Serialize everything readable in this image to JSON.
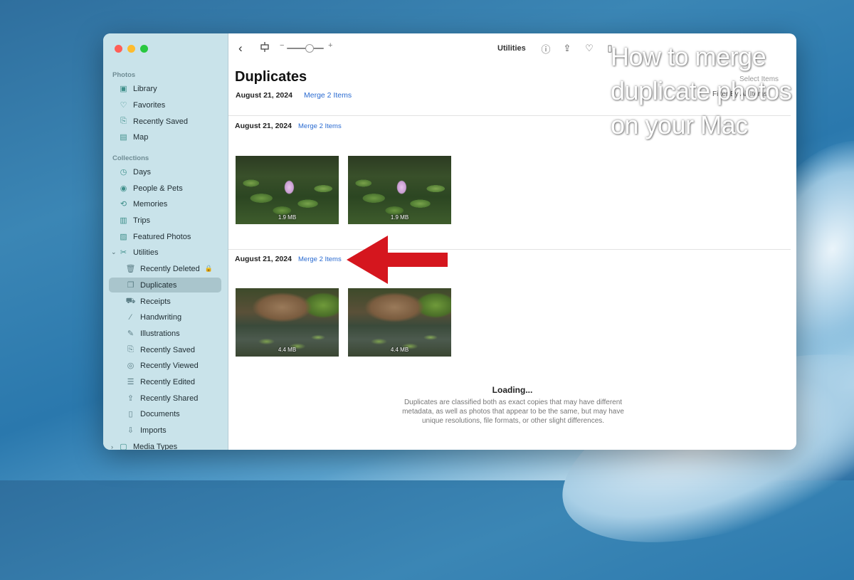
{
  "overlay": {
    "title_line1": "How to merge",
    "title_line2": "duplicate photos",
    "title_line3": "on your Mac"
  },
  "sidebar": {
    "section_photos": "Photos",
    "photos_items": [
      {
        "label": "Library",
        "icon": "library-icon"
      },
      {
        "label": "Favorites",
        "icon": "heart-icon"
      },
      {
        "label": "Recently Saved",
        "icon": "recently-saved-icon"
      },
      {
        "label": "Map",
        "icon": "map-icon"
      }
    ],
    "section_collections": "Collections",
    "collections_items": [
      {
        "label": "Days",
        "icon": "clock-icon"
      },
      {
        "label": "People & Pets",
        "icon": "person-icon"
      },
      {
        "label": "Memories",
        "icon": "memories-icon"
      },
      {
        "label": "Trips",
        "icon": "suitcase-icon"
      },
      {
        "label": "Featured Photos",
        "icon": "photo-icon"
      },
      {
        "label": "Utilities",
        "icon": "utilities-icon"
      }
    ],
    "utilities_items": [
      {
        "label": "Recently Deleted",
        "icon": "trash-icon"
      },
      {
        "label": "Duplicates",
        "icon": "duplicates-icon"
      },
      {
        "label": "Receipts",
        "icon": "cart-icon"
      },
      {
        "label": "Handwriting",
        "icon": "pen-icon"
      },
      {
        "label": "Illustrations",
        "icon": "illustration-icon"
      },
      {
        "label": "Recently Saved",
        "icon": "recently-saved-icon"
      },
      {
        "label": "Recently Viewed",
        "icon": "eye-icon"
      },
      {
        "label": "Recently Edited",
        "icon": "sliders-icon"
      },
      {
        "label": "Recently Shared",
        "icon": "share-icon"
      },
      {
        "label": "Documents",
        "icon": "document-icon"
      },
      {
        "label": "Imports",
        "icon": "import-icon"
      }
    ],
    "media_types": "Media Types",
    "selected": "Duplicates"
  },
  "toolbar": {
    "title": "Utilities"
  },
  "main": {
    "page_title": "Duplicates",
    "header_date": "August 21, 2024",
    "header_merge": "Merge 2 Items",
    "select_items": "Select Items",
    "filter_items": "Filter By All Items"
  },
  "groups": [
    {
      "date": "August 21, 2024",
      "merge_label": "Merge 2 Items",
      "photos": [
        {
          "size": "1.9 MB"
        },
        {
          "size": "1.9 MB"
        }
      ]
    },
    {
      "date": "August 21, 2024",
      "merge_label": "Merge 2 Items",
      "photos": [
        {
          "size": "4.4 MB"
        },
        {
          "size": "4.4 MB"
        }
      ]
    }
  ],
  "footer": {
    "loading": "Loading...",
    "description": "Duplicates are classified both as exact copies that may have different metadata, as well as photos that appear to be the same, but may have unique resolutions, file formats, or other slight differences."
  },
  "colors": {
    "accent": "#2a6bd1",
    "sidebar_bg": "#c9e3ea",
    "arrow": "#d5161e"
  }
}
